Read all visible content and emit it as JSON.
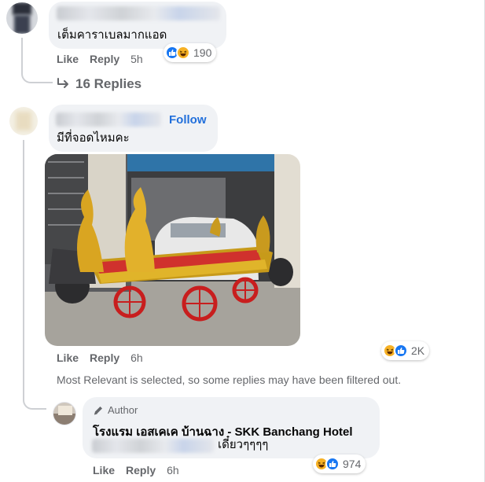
{
  "comments": [
    {
      "text": "เต็มคาราเบลมากแอด",
      "actions": {
        "like": "Like",
        "reply": "Reply",
        "time": "5h"
      },
      "reactions": {
        "count": "190",
        "icons": [
          "like-icon",
          "haha-icon"
        ]
      },
      "replies_link": "16 Replies"
    },
    {
      "follow_label": "Follow",
      "text": "มีที่จอดไหมคะ",
      "photo_alt": "ornate golden naga-headed cart with red wheels parked in a garage",
      "actions": {
        "like": "Like",
        "reply": "Reply",
        "time": "6h"
      },
      "reactions": {
        "count": "2K",
        "icons": [
          "haha-icon",
          "like-icon"
        ]
      }
    }
  ],
  "filter_notice": "Most Relevant is selected, so some replies may have been filtered out.",
  "reply": {
    "badge": "Author",
    "author_name": "โรงแรม เอสเคเค บ้านฉาง - SKK Banchang Hotel",
    "text": "เดี๋ยวๆๆๆๆ",
    "actions": {
      "like": "Like",
      "reply": "Reply",
      "time": "6h"
    },
    "reactions": {
      "count": "974",
      "icons": [
        "haha-icon",
        "like-icon"
      ]
    }
  },
  "colors": {
    "link_blue": "#216fdb",
    "bubble_bg": "#f0f2f5",
    "meta_gray": "#65676b"
  }
}
